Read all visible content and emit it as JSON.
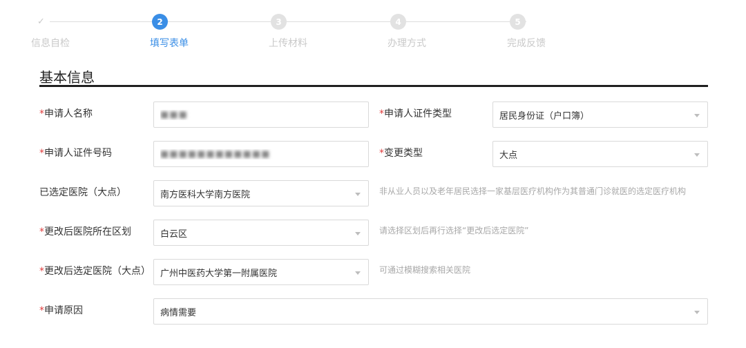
{
  "stepper": {
    "steps": [
      {
        "number": "✓",
        "label": "信息自检"
      },
      {
        "number": "2",
        "label": "填写表单"
      },
      {
        "number": "3",
        "label": "上传材料"
      },
      {
        "number": "4",
        "label": "办理方式"
      },
      {
        "number": "5",
        "label": "完成反馈"
      }
    ]
  },
  "section": {
    "title": "基本信息"
  },
  "form": {
    "required_mark": "*",
    "applicant_name": {
      "label": "申请人名称",
      "value": "■■■"
    },
    "applicant_id_type": {
      "label": "申请人证件类型",
      "value": "居民身份证（户口簿）"
    },
    "applicant_id_number": {
      "label": "申请人证件号码",
      "value": "■■■■■■■■■■■■"
    },
    "change_type": {
      "label": "变更类型",
      "value": "大点"
    },
    "selected_hospital": {
      "label": "已选定医院（大点）",
      "value": "南方医科大学南方医院",
      "hint": "非从业人员以及老年居民选择一家基层医疗机构作为其普通门诊就医的选定医疗机构"
    },
    "new_hospital_district": {
      "label": "更改后医院所在区划",
      "value": "白云区",
      "hint": "请选择区划后再行选择“更改后选定医院”"
    },
    "new_hospital": {
      "label": "更改后选定医院（大点）",
      "value": "广州中医药大学第一附属医院",
      "hint": "可通过模糊搜索相关医院"
    },
    "reason": {
      "label": "申请原因",
      "value": "病情需要"
    }
  }
}
